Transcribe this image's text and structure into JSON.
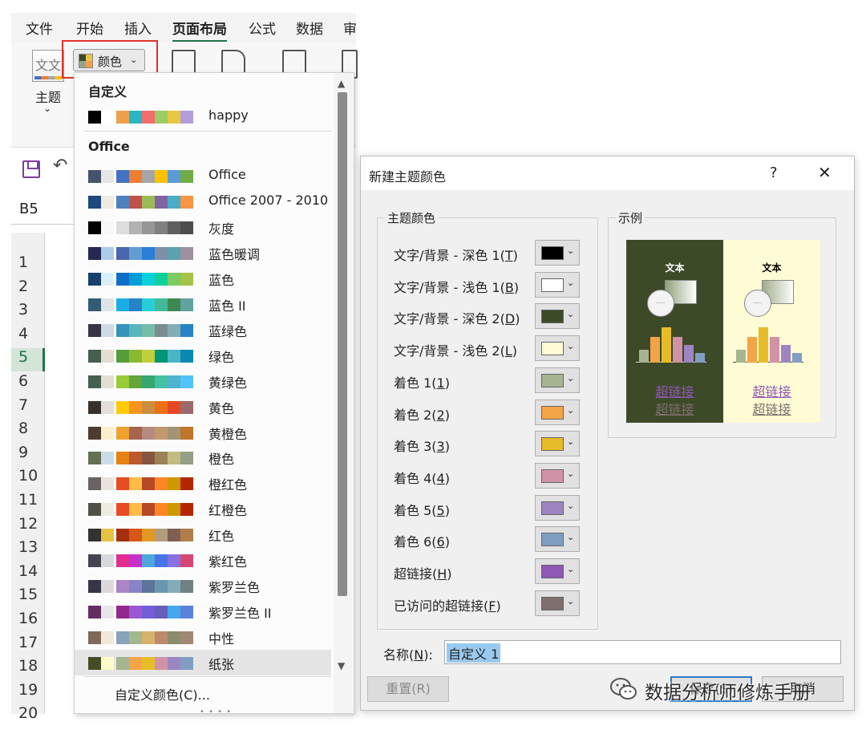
{
  "ribbon": {
    "tabs": [
      "文件",
      "开始",
      "插入",
      "页面布局",
      "公式",
      "数据",
      "审"
    ],
    "active_tab": "页面布局",
    "theme_label": "主题",
    "colors_button": "颜色"
  },
  "name_box": "B5",
  "rows": [
    "1",
    "2",
    "3",
    "4",
    "5",
    "6",
    "7",
    "8",
    "9",
    "10",
    "11",
    "12",
    "13",
    "14",
    "15",
    "16",
    "17",
    "18",
    "19",
    "20"
  ],
  "selected_row": "5",
  "dropdown": {
    "custom_section": "自定义",
    "custom_palettes": [
      {
        "name": "happy",
        "colors": [
          "#000000",
          "#ffffff",
          "#f0a04b",
          "#2ab5c4",
          "#f26c6c",
          "#9ccc65",
          "#e8c840",
          "#b39ddb"
        ]
      }
    ],
    "office_section": "Office",
    "office_palettes": [
      {
        "name": "Office",
        "colors": [
          "#44546a",
          "#e7e6e6",
          "#4472c4",
          "#ed7d31",
          "#a5a5a5",
          "#ffc000",
          "#5b9bd5",
          "#70ad47"
        ]
      },
      {
        "name": "Office 2007 - 2010",
        "colors": [
          "#1f497d",
          "#eeece1",
          "#4f81bd",
          "#c0504d",
          "#9bbb59",
          "#8064a2",
          "#4bacc6",
          "#f79646"
        ]
      },
      {
        "name": "灰度",
        "colors": [
          "#000000",
          "#f8f8f8",
          "#dddddd",
          "#b2b2b2",
          "#969696",
          "#808080",
          "#5f5f5f",
          "#4d4d4d"
        ]
      },
      {
        "name": "蓝色暖调",
        "colors": [
          "#242852",
          "#acccea",
          "#4a66ac",
          "#629dd1",
          "#297fd5",
          "#7f8fa9",
          "#5aa2ae",
          "#9d90a0"
        ]
      },
      {
        "name": "蓝色",
        "colors": [
          "#17406d",
          "#dbeff9",
          "#0f6fc6",
          "#009dd9",
          "#0bd0d9",
          "#10cf9b",
          "#7cca62",
          "#a5c249"
        ]
      },
      {
        "name": "蓝色 II",
        "colors": [
          "#335b74",
          "#dfe3e5",
          "#1cade4",
          "#2683c6",
          "#27ced7",
          "#42ba97",
          "#3e8853",
          "#62a39f"
        ]
      },
      {
        "name": "蓝绿色",
        "colors": [
          "#373545",
          "#cedbe6",
          "#3494ba",
          "#58b6c0",
          "#75bda7",
          "#7a8c8e",
          "#84acb6",
          "#2683c6"
        ]
      },
      {
        "name": "绿色",
        "colors": [
          "#455f51",
          "#e3ded1",
          "#549e39",
          "#8ab833",
          "#c0cf3a",
          "#029676",
          "#4ab5c4",
          "#0989b1"
        ]
      },
      {
        "name": "黄绿色",
        "colors": [
          "#455f51",
          "#e3ded1",
          "#99cb38",
          "#63a537",
          "#37a76f",
          "#44c1a3",
          "#4eb3cf",
          "#51c3f9"
        ]
      },
      {
        "name": "黄色",
        "colors": [
          "#39302a",
          "#e5dedb",
          "#ffca08",
          "#f8931d",
          "#ce8d3e",
          "#ec7016",
          "#e64823",
          "#9c6a6a"
        ]
      },
      {
        "name": "黄橙色",
        "colors": [
          "#4e3b30",
          "#fbeec9",
          "#f0a22e",
          "#a5644e",
          "#b58b80",
          "#c3986d",
          "#a19574",
          "#c17529"
        ]
      },
      {
        "name": "橙色",
        "colors": [
          "#637052",
          "#ccddea",
          "#e48312",
          "#bd582c",
          "#865640",
          "#9b8357",
          "#c2bc80",
          "#94a088"
        ]
      },
      {
        "name": "橙红色",
        "colors": [
          "#696464",
          "#e9e5dc",
          "#e84c22",
          "#ffbd47",
          "#b64926",
          "#ff8427",
          "#cc9900",
          "#b22600"
        ]
      },
      {
        "name": "红橙色",
        "colors": [
          "#505046",
          "#eeece1",
          "#e84c22",
          "#ffbd47",
          "#b64926",
          "#ff8427",
          "#cc9900",
          "#b22600"
        ]
      },
      {
        "name": "红色",
        "colors": [
          "#323232",
          "#e5c243",
          "#a5300f",
          "#d55816",
          "#e19825",
          "#b19c7d",
          "#7f5f52",
          "#b27d49"
        ]
      },
      {
        "name": "紫红色",
        "colors": [
          "#454551",
          "#d8d9dc",
          "#e32d91",
          "#c830cc",
          "#4ea6dc",
          "#4775e7",
          "#8971e1",
          "#d54773"
        ]
      },
      {
        "name": "紫罗兰色",
        "colors": [
          "#373545",
          "#dcd8dc",
          "#ad84c6",
          "#8784c7",
          "#5d739a",
          "#6997af",
          "#84acb6",
          "#6f8183"
        ]
      },
      {
        "name": "紫罗兰色 II",
        "colors": [
          "#632e62",
          "#eae5eb",
          "#92278f",
          "#9b57d3",
          "#755dd9",
          "#665eb8",
          "#45a5ed",
          "#5982db"
        ]
      },
      {
        "name": "中性",
        "colors": [
          "#7f6a57",
          "#f2e8d8",
          "#88a3ba",
          "#a4b88f",
          "#d6b26c",
          "#bf8a6c",
          "#8b8c6b",
          "#a28774"
        ]
      },
      {
        "name": "纸张",
        "colors": [
          "#444d26",
          "#fefac9",
          "#a5b592",
          "#f3a447",
          "#e7bc29",
          "#d092a7",
          "#9c85c0",
          "#809ec2"
        ]
      }
    ],
    "selected": "纸张",
    "custom_colors_link": "自定义颜色(C)..."
  },
  "dialog": {
    "title": "新建主题颜色",
    "help": "?",
    "close": "✕",
    "theme_group": "主题颜色",
    "sample_group": "示例",
    "fields": [
      {
        "label": "文字/背景 - 深色 1",
        "key": "T",
        "color": "#000000"
      },
      {
        "label": "文字/背景 - 浅色 1",
        "key": "B",
        "color": "#ffffff"
      },
      {
        "label": "文字/背景 - 深色 2",
        "key": "D",
        "color": "#3d4a28"
      },
      {
        "label": "文字/背景 - 浅色 2",
        "key": "L",
        "color": "#fefbd5"
      },
      {
        "label": "着色 1",
        "key": "1",
        "color": "#a5b592"
      },
      {
        "label": "着色 2",
        "key": "2",
        "color": "#f3a447"
      },
      {
        "label": "着色 3",
        "key": "3",
        "color": "#e7bc29"
      },
      {
        "label": "着色 4",
        "key": "4",
        "color": "#d092a7"
      },
      {
        "label": "着色 5",
        "key": "5",
        "color": "#9c85c0"
      },
      {
        "label": "着色 6",
        "key": "6",
        "color": "#809ec2"
      },
      {
        "label": "超链接",
        "key": "H",
        "color": "#8e58b6"
      },
      {
        "label": "已访问的超链接",
        "key": "F",
        "color": "#7f6f6f"
      }
    ],
    "sample": {
      "text": "文本",
      "hyperlink": "超链接",
      "visited_hyperlink": "超链接"
    },
    "name_label": "名称",
    "name_key": "N",
    "name_value": "自定义 1",
    "reset_button": "重置(R)",
    "save_button": "保存(S)",
    "cancel_button": "取消"
  },
  "watermark": "数据分析师修炼手册"
}
